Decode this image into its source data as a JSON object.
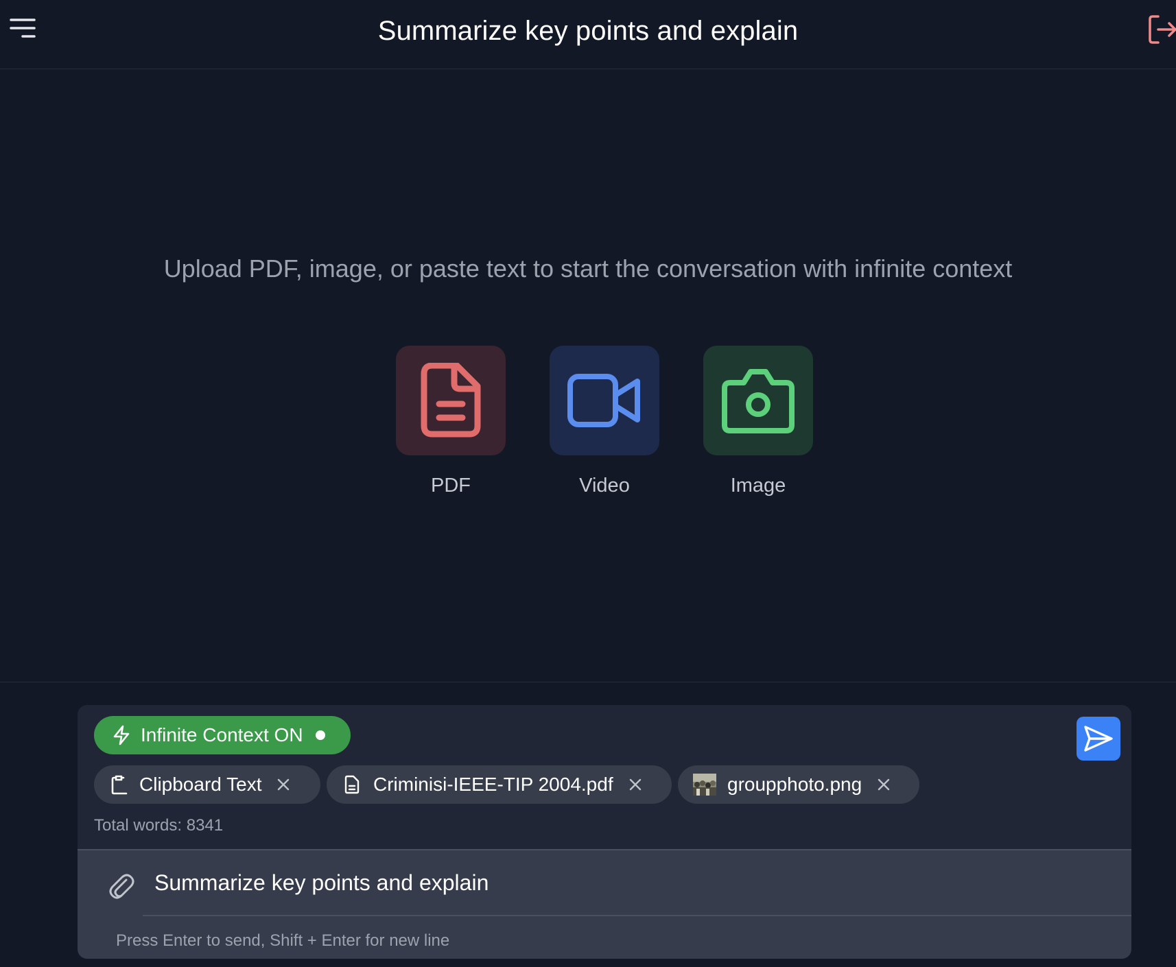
{
  "header": {
    "title": "Summarize key points and explain",
    "menu_icon": "hamburger-menu-icon",
    "logout_icon": "logout-icon"
  },
  "main": {
    "prompt": "Upload PDF, image, or paste text to start the conversation with infinite context",
    "upload_options": [
      {
        "label": "PDF",
        "icon": "file-text-icon",
        "color": "#e06c6c",
        "bg": "#3a2430"
      },
      {
        "label": "Video",
        "icon": "video-camera-icon",
        "color": "#5b8def",
        "bg": "#1e2a4b"
      },
      {
        "label": "Image",
        "icon": "camera-icon",
        "color": "#5cd07a",
        "bg": "#1e3a30"
      }
    ]
  },
  "composer": {
    "context_toggle": {
      "label": "Infinite Context ON",
      "icon": "lightning-icon",
      "color": "#3a9a4a",
      "state": "on"
    },
    "attachments": [
      {
        "name": "Clipboard Text",
        "icon": "clipboard-icon"
      },
      {
        "name": "Criminisi-IEEE-TIP 2004.pdf",
        "icon": "document-icon"
      },
      {
        "name": "groupphoto.png",
        "icon": "image-thumbnail"
      }
    ],
    "total_words": "Total words: 8341",
    "input_value": "Summarize key points and explain",
    "hint": "Press Enter to send, Shift + Enter for new line",
    "send_icon": "send-icon",
    "attach_icon": "paperclip-icon",
    "send_color": "#3b82f6"
  }
}
